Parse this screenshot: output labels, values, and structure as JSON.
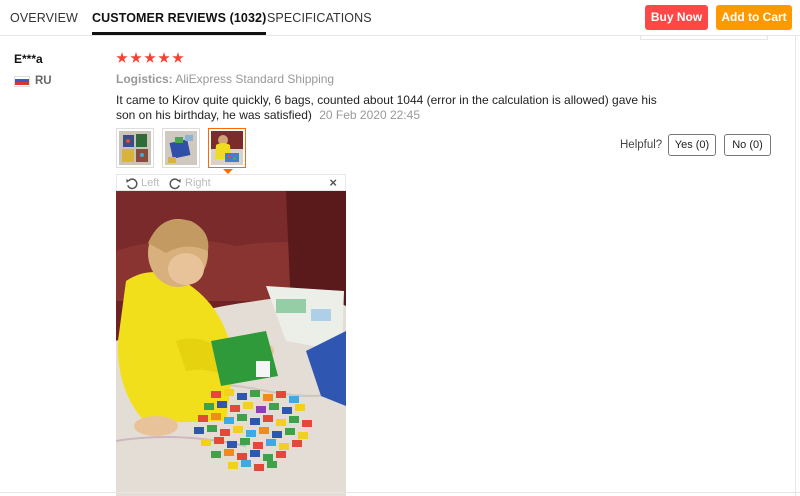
{
  "tabs": [
    {
      "label": "OVERVIEW"
    },
    {
      "label": "CUSTOMER REVIEWS (1032)"
    },
    {
      "label": "SPECIFICATIONS"
    }
  ],
  "actions": {
    "buy_now": "Buy Now",
    "add_to_cart": "Add to Cart"
  },
  "colors": {
    "buy_now": "#ff4747",
    "add_to_cart": "#ff9900",
    "stars": "#f44336",
    "thumb_active": "#ff6a00"
  },
  "review": {
    "user": "E***a",
    "country": "RU",
    "rating": 5,
    "logistics_label": "Logistics:",
    "logistics_value": "AliExpress Standard Shipping",
    "text": "It came to Kirov quite quickly, 6 bags, counted about 1044 (error in the calculation is allowed) gave his son on his birthday, he was satisfied)",
    "date": "20 Feb 2020 22:45",
    "thumbnails": [
      "photo-1",
      "photo-2",
      "photo-3"
    ],
    "active_thumbnail": 3,
    "helpful_label": "Helpful?",
    "yes_label": "Yes (0)",
    "no_label": "No (0)"
  },
  "viewer": {
    "rotate_left": "Left",
    "rotate_right": "Right",
    "close": "×"
  }
}
